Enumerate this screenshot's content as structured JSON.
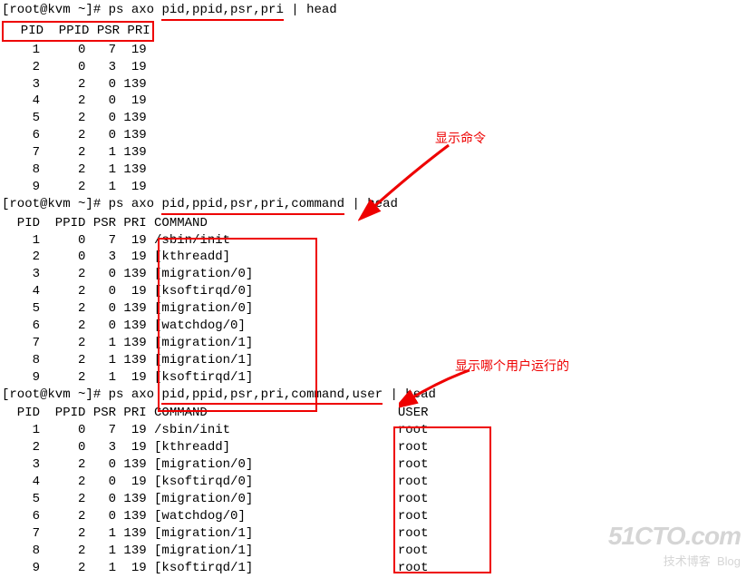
{
  "prompts": {
    "prefix": "[root@kvm ~]# ",
    "cmd1_pre": "ps axo ",
    "cmd1_args": "pid,ppid,psr,pri",
    "cmd1_post": " | head",
    "cmd2_pre": "ps axo ",
    "cmd2_args": "pid,ppid,psr,pri,",
    "cmd2_command": "command",
    "cmd2_post": " | head",
    "cmd3_pre": "ps axo ",
    "cmd3_args": "pid,ppid,psr,pri,command,",
    "cmd3_user": "user",
    "cmd3_post": " | head"
  },
  "headers": {
    "block1": "  PID  PPID PSR PRI",
    "block2_pre": "  PID  PPID PSR PRI ",
    "block2_cmd": "COMMAND",
    "block3_pre": "  PID  PPID PSR PRI COMMAND",
    "block3_user": "USER"
  },
  "block1": {
    "rows": [
      "    1     0   7  19",
      "    2     0   3  19",
      "    3     2   0 139",
      "    4     2   0  19",
      "    5     2   0 139",
      "    6     2   0 139",
      "    7     2   1 139",
      "    8     2   1 139",
      "    9     2   1  19"
    ]
  },
  "block2": {
    "rows": [
      {
        "pre": "    1     0   7  19 ",
        "cmd": "/sbin/init"
      },
      {
        "pre": "    2     0   3  19 ",
        "cmd": "[kthreadd]"
      },
      {
        "pre": "    3     2   0 139 ",
        "cmd": "[migration/0]"
      },
      {
        "pre": "    4     2   0  19 ",
        "cmd": "[ksoftirqd/0]"
      },
      {
        "pre": "    5     2   0 139 ",
        "cmd": "[migration/0]"
      },
      {
        "pre": "    6     2   0 139 ",
        "cmd": "[watchdog/0]"
      },
      {
        "pre": "    7     2   1 139 ",
        "cmd": "[migration/1]"
      },
      {
        "pre": "    8     2   1 139 ",
        "cmd": "[migration/1]"
      },
      {
        "pre": "    9     2   1  19 ",
        "cmd": "[ksoftirqd/1]"
      }
    ]
  },
  "block3": {
    "rows": [
      {
        "line": "    1     0   7  19 /sbin/init",
        "user": "root"
      },
      {
        "line": "    2     0   3  19 [kthreadd]",
        "user": "root"
      },
      {
        "line": "    3     2   0 139 [migration/0]",
        "user": "root"
      },
      {
        "line": "    4     2   0  19 [ksoftirqd/0]",
        "user": "root"
      },
      {
        "line": "    5     2   0 139 [migration/0]",
        "user": "root"
      },
      {
        "line": "    6     2   0 139 [watchdog/0]",
        "user": "root"
      },
      {
        "line": "    7     2   1 139 [migration/1]",
        "user": "root"
      },
      {
        "line": "    8     2   1 139 [migration/1]",
        "user": "root"
      },
      {
        "line": "    9     2   1  19 [ksoftirqd/1]",
        "user": "root"
      }
    ]
  },
  "annotations": {
    "label1": "显示命令",
    "label2": "显示哪个用户运行的"
  },
  "watermark": {
    "big": "51CTO.com",
    "small_left": "技术博客",
    "small_right": "Blog"
  }
}
